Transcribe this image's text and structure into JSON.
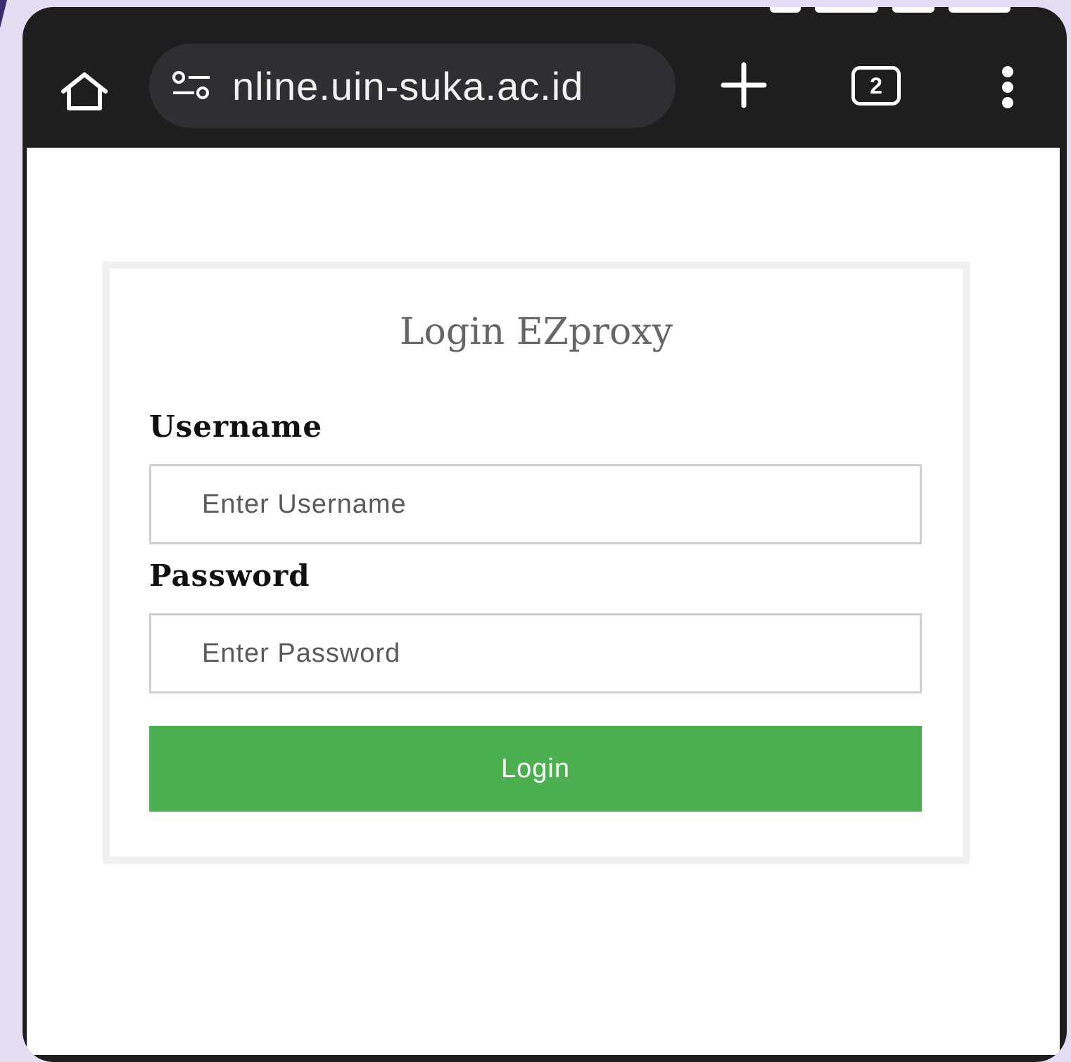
{
  "browser": {
    "url": "nline.uin-suka.ac.id",
    "tab_count": "2",
    "icons": {
      "home": "home-icon",
      "site_settings": "tune-icon",
      "new_tab": "plus-icon",
      "tabs": "tab-switcher-icon",
      "menu": "more-vert-icon"
    }
  },
  "form": {
    "title": "Login EZproxy",
    "username_label": "Username",
    "username_placeholder": "Enter Username",
    "password_label": "Password",
    "password_placeholder": "Enter Password",
    "submit_label": "Login"
  },
  "colors": {
    "toolbar_bg": "#1e1e1e",
    "url_pill_bg": "#2f2f33",
    "button_green": "#4caf50",
    "page_bg": "#e4dcf3"
  }
}
